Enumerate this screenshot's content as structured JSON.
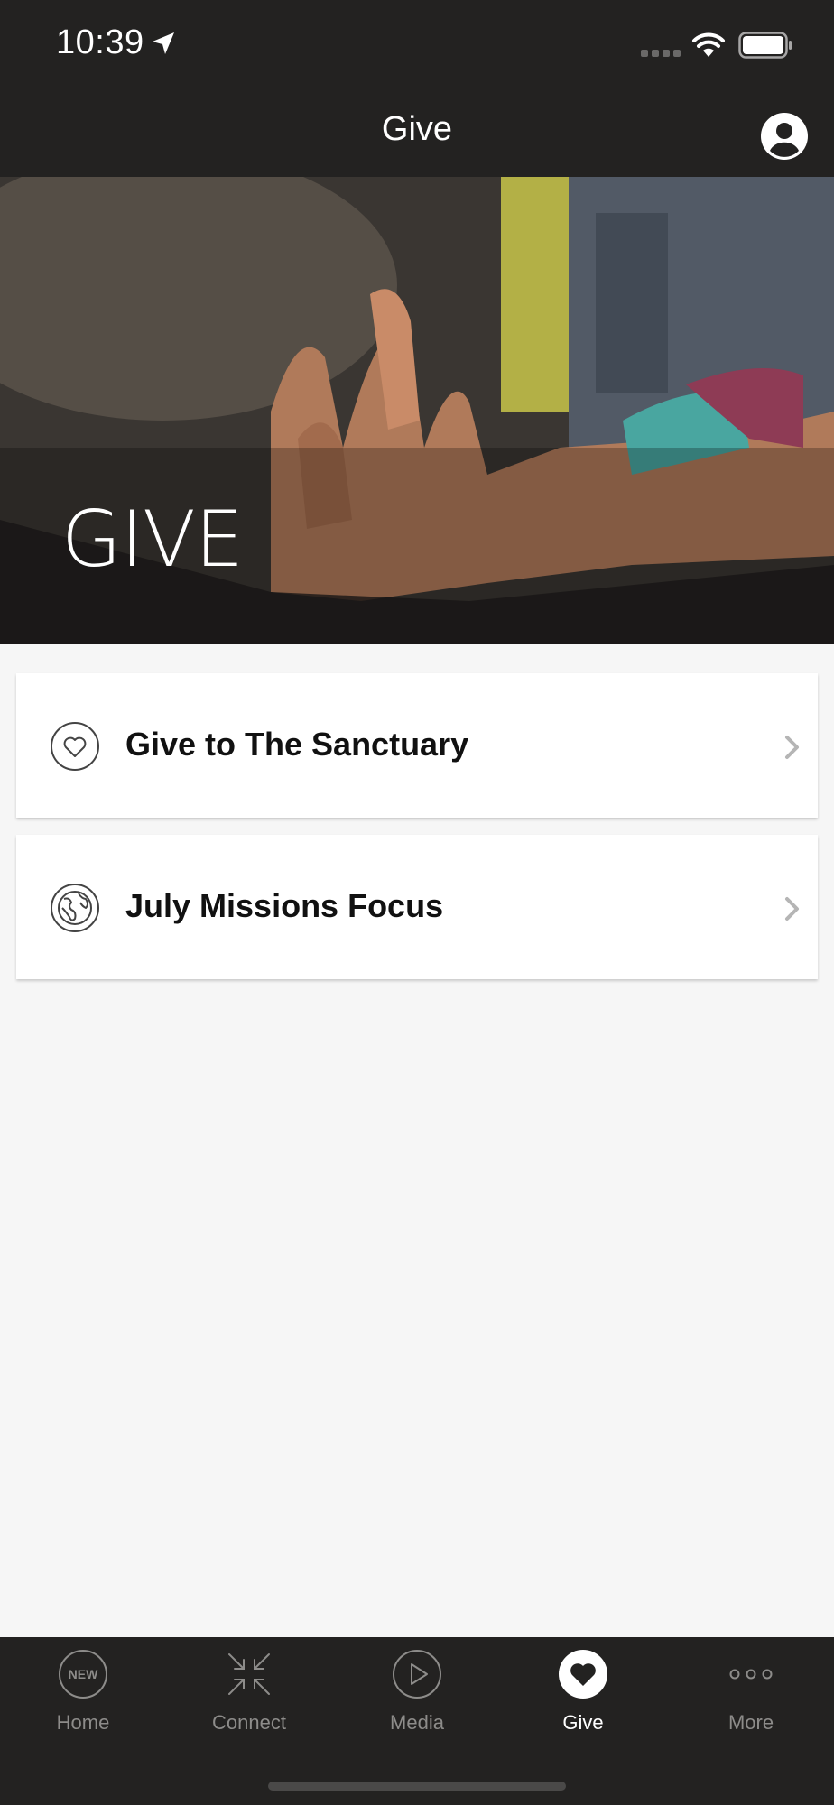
{
  "status_bar": {
    "time": "10:39",
    "icons": [
      "location-arrow-icon",
      "signal-icon",
      "wifi-icon",
      "battery-icon"
    ]
  },
  "nav": {
    "title": "Give",
    "profile_icon": "person-icon"
  },
  "hero": {
    "title": "GIVE"
  },
  "items": [
    {
      "label": "Give to The Sanctuary",
      "icon": "heart-outline-icon"
    },
    {
      "label": "July Missions Focus",
      "icon": "globe-icon"
    }
  ],
  "tabs": [
    {
      "label": "Home",
      "icon": "new-badge-icon",
      "icon_text": "NEW",
      "active": false
    },
    {
      "label": "Connect",
      "icon": "compress-arrows-icon",
      "active": false
    },
    {
      "label": "Media",
      "icon": "play-icon",
      "active": false
    },
    {
      "label": "Give",
      "icon": "heart-icon",
      "active": true
    },
    {
      "label": "More",
      "icon": "ellipsis-icon",
      "active": false
    }
  ],
  "colors": {
    "bar_background": "#232221",
    "page_background": "#f6f6f6",
    "active_tab": "#ffffff",
    "inactive_tab": "#8d8c8a"
  }
}
